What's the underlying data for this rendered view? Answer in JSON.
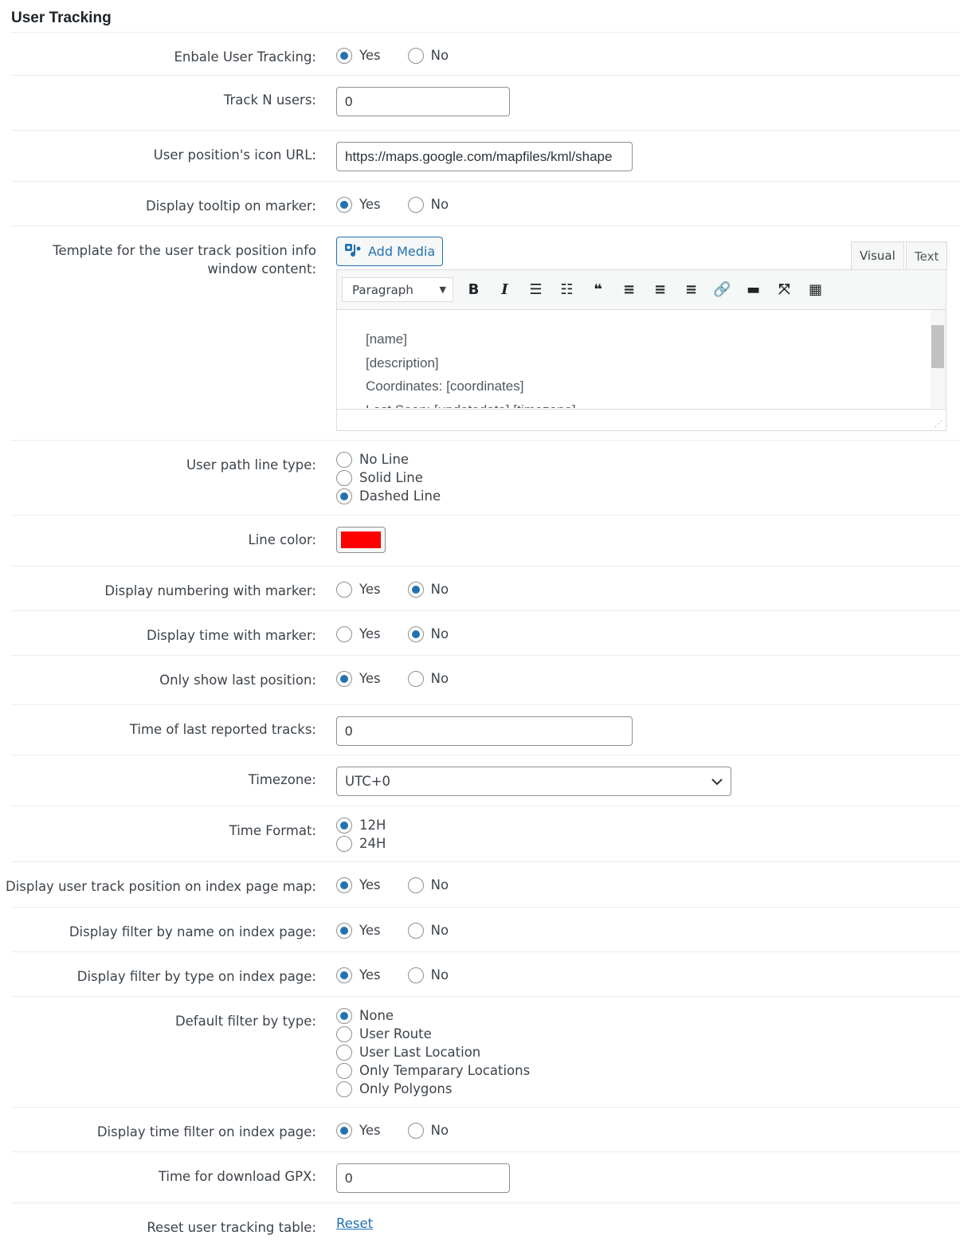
{
  "section_title": "User Tracking",
  "rows": [
    {
      "label": "Enbale User Tracking:",
      "type": "radio-inline",
      "options": [
        "Yes",
        "No"
      ],
      "selected": 0
    },
    {
      "label": "Track N users:",
      "type": "text",
      "value": "0",
      "width": "small"
    },
    {
      "label": "User position's icon URL:",
      "type": "text",
      "value": "https://maps.google.com/mapfiles/kml/shape",
      "width": "medium"
    },
    {
      "label": "Display tooltip on marker:",
      "type": "radio-inline",
      "options": [
        "Yes",
        "No"
      ],
      "selected": 0
    },
    {
      "label": "Template for the user track position info window content:",
      "type": "editor"
    },
    {
      "label": "User path line type:",
      "type": "radio-col",
      "options": [
        "No Line",
        "Solid Line",
        "Dashed Line"
      ],
      "selected": 2
    },
    {
      "label": "Line color:",
      "type": "color",
      "color": "#ff0000"
    },
    {
      "label": "Display numbering with marker:",
      "type": "radio-inline",
      "options": [
        "Yes",
        "No"
      ],
      "selected": 1
    },
    {
      "label": "Display time with marker:",
      "type": "radio-inline",
      "options": [
        "Yes",
        "No"
      ],
      "selected": 1
    },
    {
      "label": "Only show last position:",
      "type": "radio-inline",
      "options": [
        "Yes",
        "No"
      ],
      "selected": 0
    },
    {
      "label": "Time of last reported tracks:",
      "type": "text",
      "value": "0",
      "width": "medium"
    },
    {
      "label": "Timezone:",
      "type": "select",
      "value": "UTC+0"
    },
    {
      "label": "Time Format:",
      "type": "radio-col",
      "options": [
        "12H",
        "24H"
      ],
      "selected": 0
    },
    {
      "label": "Display user track position on index page map:",
      "type": "radio-inline",
      "options": [
        "Yes",
        "No"
      ],
      "selected": 0
    },
    {
      "label": "Display filter by name on index page:",
      "type": "radio-inline",
      "options": [
        "Yes",
        "No"
      ],
      "selected": 0
    },
    {
      "label": "Display filter by type on index page:",
      "type": "radio-inline",
      "options": [
        "Yes",
        "No"
      ],
      "selected": 0
    },
    {
      "label": "Default filter by type:",
      "type": "radio-col",
      "options": [
        "None",
        "User Route",
        "User Last Location",
        "Only Temparary Locations",
        "Only Polygons"
      ],
      "selected": 0
    },
    {
      "label": "Display time filter on index page:",
      "type": "radio-inline",
      "options": [
        "Yes",
        "No"
      ],
      "selected": 0
    },
    {
      "label": "Time for download GPX:",
      "type": "text",
      "value": "0",
      "width": "small"
    },
    {
      "label": "Reset user tracking table:",
      "type": "link",
      "value": "Reset"
    }
  ],
  "editor": {
    "add_media_label": "Add Media",
    "tabs": [
      "Visual",
      "Text"
    ],
    "active_tab": "Visual",
    "format_select": "Paragraph",
    "toolbar": [
      "bold-icon",
      "italic-icon",
      "bullet-list-icon",
      "numbered-list-icon",
      "blockquote-icon",
      "align-left-icon",
      "align-center-icon",
      "align-right-icon",
      "link-icon",
      "read-more-icon",
      "fullscreen-icon",
      "toolbar-toggle-icon"
    ],
    "lines": [
      "[name]",
      "[description]",
      "Coordinates: [coordinates]",
      "Last Seen: [updatedate] [timezone]"
    ]
  },
  "accent_color": "#2271b1"
}
